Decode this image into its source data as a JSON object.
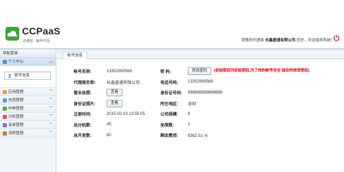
{
  "header": {
    "brand": "CCPaaS",
    "slogan": "云通信 · 触手可及",
    "welcome_prefix": "尊敬的代理商",
    "company": "长鑫盛通有限公司",
    "welcome_suffix": ":您好，欢迎使用系统!",
    "colors": {
      "brand_green": "#3aa53a",
      "power_red": "#e02020"
    }
  },
  "sidebar": {
    "title": "导航菜单",
    "groups": [
      {
        "label": "个人中心",
        "active": true,
        "icon": "person-icon",
        "sub_items": [
          {
            "label": "账号信息",
            "icon": "user-icon"
          }
        ]
      },
      {
        "label": "应用管理",
        "icon": "app-icon"
      },
      {
        "label": "充值管理",
        "icon": "recharge-icon"
      },
      {
        "label": "中继管理",
        "icon": "relay-icon"
      },
      {
        "label": "分机管理",
        "icon": "extension-icon"
      },
      {
        "label": "话单管理",
        "icon": "bill-icon"
      },
      {
        "label": "消费管理",
        "icon": "consume-icon"
      }
    ]
  },
  "tabs": [
    {
      "label": "帐号信息"
    }
  ],
  "account": {
    "rows": [
      {
        "l1": "帐号名称:",
        "v1": "13352999566",
        "l2": "密  码:",
        "btn": "修改密码",
        "warn": "(初始密码为初始密码,为了你的帐号安全 请及时修改密码)"
      },
      {
        "l1": "代理商名称:",
        "v1": "长鑫盛通有限公司",
        "l2": "电话号码:",
        "v2": "13352999566"
      },
      {
        "l1": "营业执照:",
        "btn1": "查看",
        "l2": "身份证号码:",
        "v2": "888888888888888"
      },
      {
        "l1": "身份证照片:",
        "btn1": "查看",
        "l2": "所在地区:",
        "v2": "深圳"
      },
      {
        "l1": "注册时间:",
        "v1": "2015-02-03 13:55:05",
        "l2": "公司规模:",
        "v2": "8"
      },
      {
        "l1": "总分机数:",
        "v1": "45",
        "l2": "坐席数:",
        "v2": "1"
      },
      {
        "l1": "总开发数:",
        "v1": "80",
        "l2": "剩余费用:",
        "v2": "9362.01 元"
      }
    ]
  }
}
